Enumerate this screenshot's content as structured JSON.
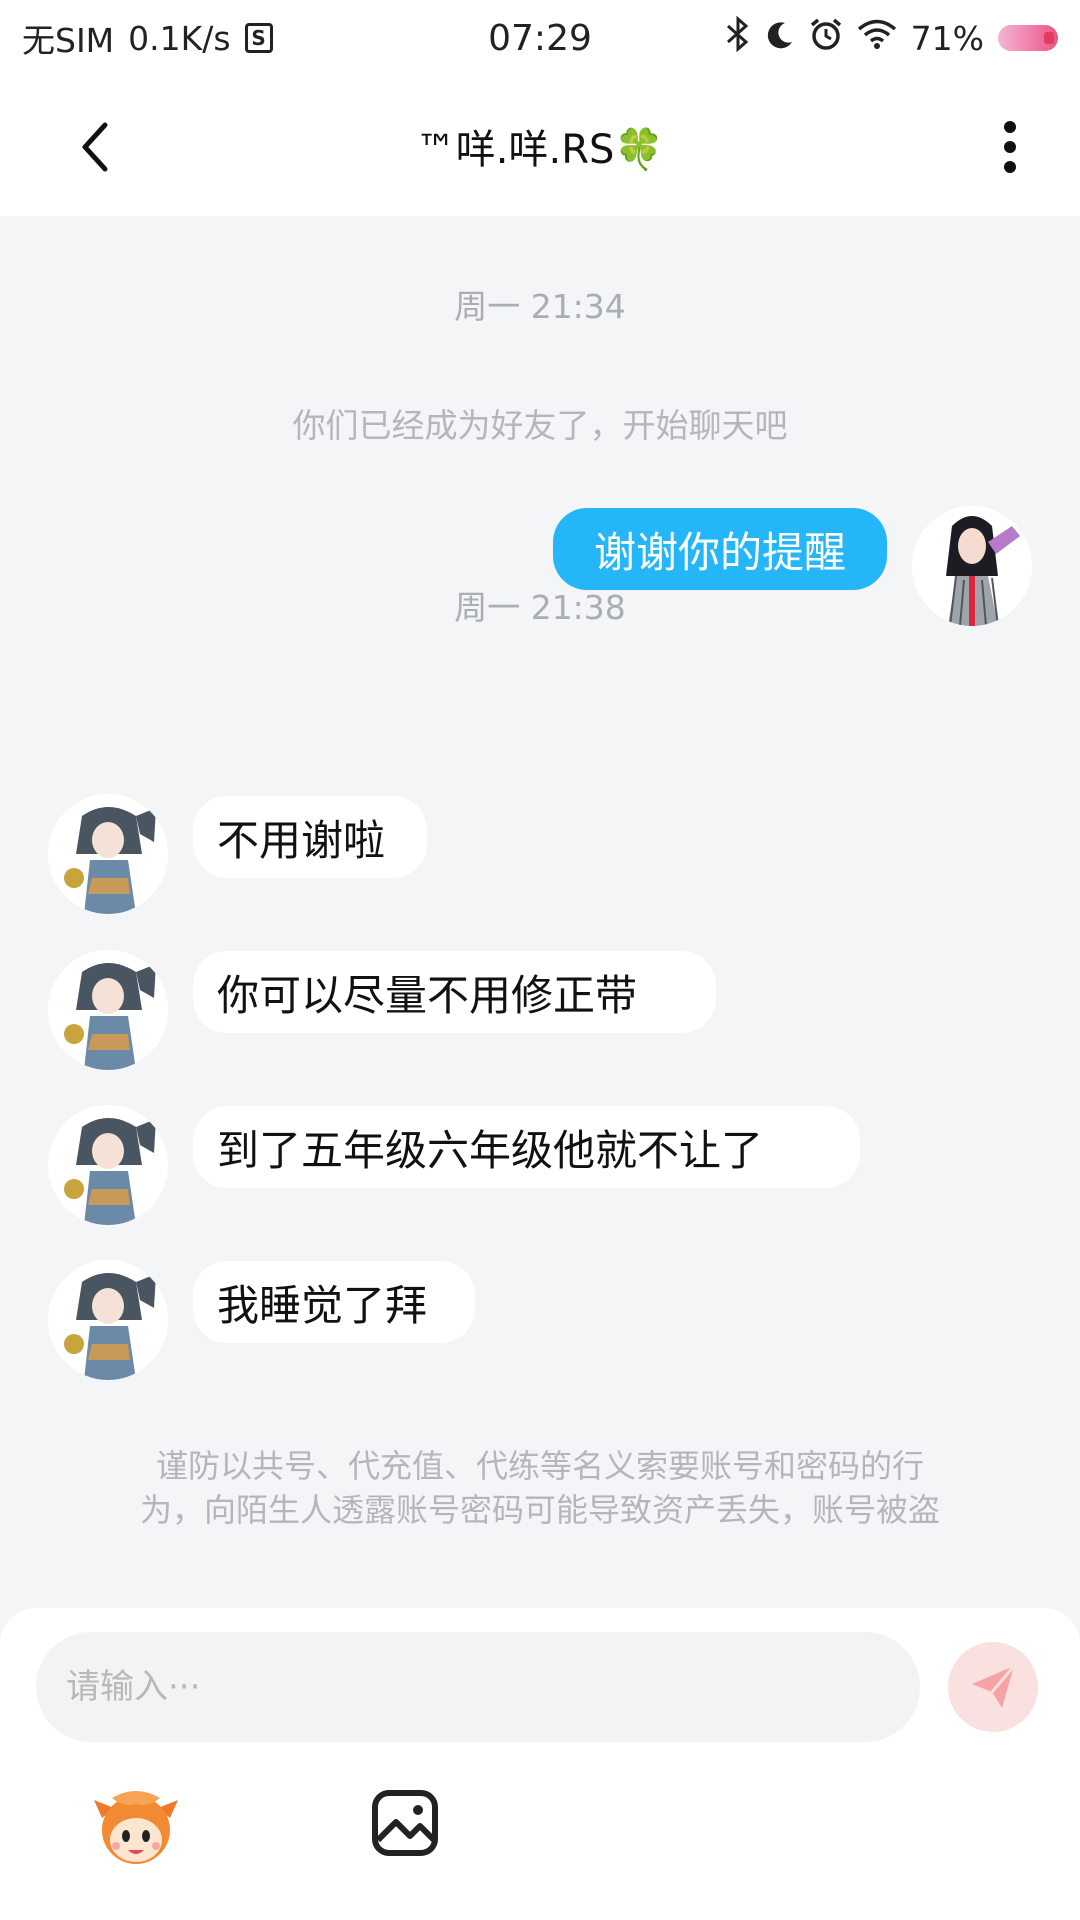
{
  "status_bar": {
    "carrier": "无SIM",
    "net_speed": "0.1K/s",
    "time": "07:29",
    "battery": "71%"
  },
  "header": {
    "title": "™咩.咩.RS🍀"
  },
  "chat": {
    "timestamp_1": "周一 21:34",
    "system_message": "你们已经成为好友了，开始聊天吧",
    "outgoing": [
      {
        "text": "谢谢你的提醒"
      }
    ],
    "timestamp_2": "周一 21:38",
    "incoming": [
      {
        "text": "不用谢啦"
      },
      {
        "text": "你可以尽量不用修正带"
      },
      {
        "text": "到了五年级六年级他就不让了"
      },
      {
        "text": "我睡觉了拜"
      }
    ],
    "warning_line_1": "谨防以共号、代充值、代练等名义索要账号和密码的行",
    "warning_line_2": "为，向陌生人透露账号密码可能导致资产丢失，账号被盗"
  },
  "input": {
    "placeholder": "请输入···"
  },
  "icons": {
    "back": "chevron-left-icon",
    "more": "more-vertical-icon",
    "send": "paper-plane-icon",
    "emoji": "mascot-emoji-icon",
    "image": "image-icon"
  },
  "colors": {
    "outgoing_bubble": "#24b6f8",
    "incoming_bubble": "#ffffff",
    "chat_background": "#f4f5f7",
    "send_button": "#fbe0e0",
    "send_icon": "#f7a3a3"
  }
}
